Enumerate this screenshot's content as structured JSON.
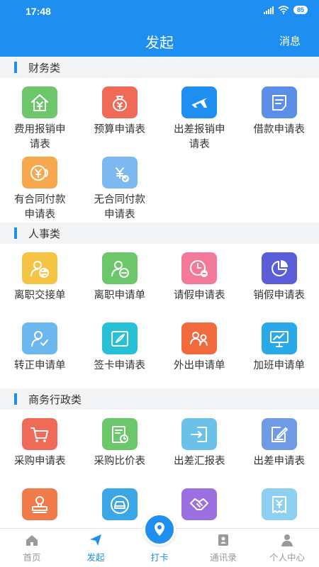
{
  "status": {
    "time": "17:48",
    "battery": "85"
  },
  "header": {
    "title": "发起",
    "message_label": "消息"
  },
  "colors": {
    "primary": "#1e8ff0"
  },
  "sections": [
    {
      "title": "财务类",
      "items": [
        {
          "label": "费用报销申请表",
          "icon": "house-yuan-icon",
          "color": "#6cc76a"
        },
        {
          "label": "预算申请表",
          "icon": "money-bag-icon",
          "color": "#f06b57"
        },
        {
          "label": "出差报销申请表",
          "icon": "airplane-icon",
          "color": "#1e8ff0"
        },
        {
          "label": "借款申请表",
          "icon": "document-icon",
          "color": "#5b8ee8"
        },
        {
          "label": "有合同付款申请表",
          "icon": "yuan-coin-icon",
          "color": "#f5a94c"
        },
        {
          "label": "无合同付款申请表",
          "icon": "yuan-check-icon",
          "color": "#7db8f0"
        }
      ]
    },
    {
      "title": "人事类",
      "items": [
        {
          "label": "离职交接单",
          "icon": "user-exchange-icon",
          "color": "#f6c445"
        },
        {
          "label": "离职申请单",
          "icon": "user-minus-icon",
          "color": "#6cc76a"
        },
        {
          "label": "请假申请表",
          "icon": "clock-minus-icon",
          "color": "#f2799a"
        },
        {
          "label": "销假申请表",
          "icon": "pie-chart-icon",
          "color": "#5a5fd9"
        },
        {
          "label": "转正申请单",
          "icon": "user-check-icon",
          "color": "#6cb8ee"
        },
        {
          "label": "签卡申请表",
          "icon": "pen-card-icon",
          "color": "#27c0d7"
        },
        {
          "label": "外出申请单",
          "icon": "users-out-icon",
          "color": "#f06a3c"
        },
        {
          "label": "加班申请单",
          "icon": "presentation-board-icon",
          "color": "#29a9e8"
        }
      ]
    },
    {
      "title": "商务行政类",
      "items": [
        {
          "label": "采购申请表",
          "icon": "shopping-cart-icon",
          "color": "#f06b57"
        },
        {
          "label": "采购比价表",
          "icon": "price-compare-icon",
          "color": "#6cc76a"
        },
        {
          "label": "出差汇报表",
          "icon": "door-enter-icon",
          "color": "#6cc1ea"
        },
        {
          "label": "出差申请表",
          "icon": "edit-doc-icon",
          "color": "#6f9be6"
        },
        {
          "label": "",
          "icon": "stamp-icon",
          "color": "#f07a4a"
        },
        {
          "label": "",
          "icon": "car-icon",
          "color": "#3ba7e6"
        },
        {
          "label": "",
          "icon": "handshake-icon",
          "color": "#9b6fe0"
        },
        {
          "label": "",
          "icon": "receipt-icon",
          "color": "#8dd0f2"
        }
      ]
    }
  ],
  "tabbar": [
    {
      "label": "首页",
      "icon": "home-icon",
      "active": false
    },
    {
      "label": "发起",
      "icon": "send-icon",
      "active": true
    },
    {
      "label": "打卡",
      "icon": "punch-location-icon",
      "active": true,
      "center": true
    },
    {
      "label": "通讯录",
      "icon": "contacts-icon",
      "active": false
    },
    {
      "label": "个人中心",
      "icon": "person-icon",
      "active": false
    }
  ]
}
